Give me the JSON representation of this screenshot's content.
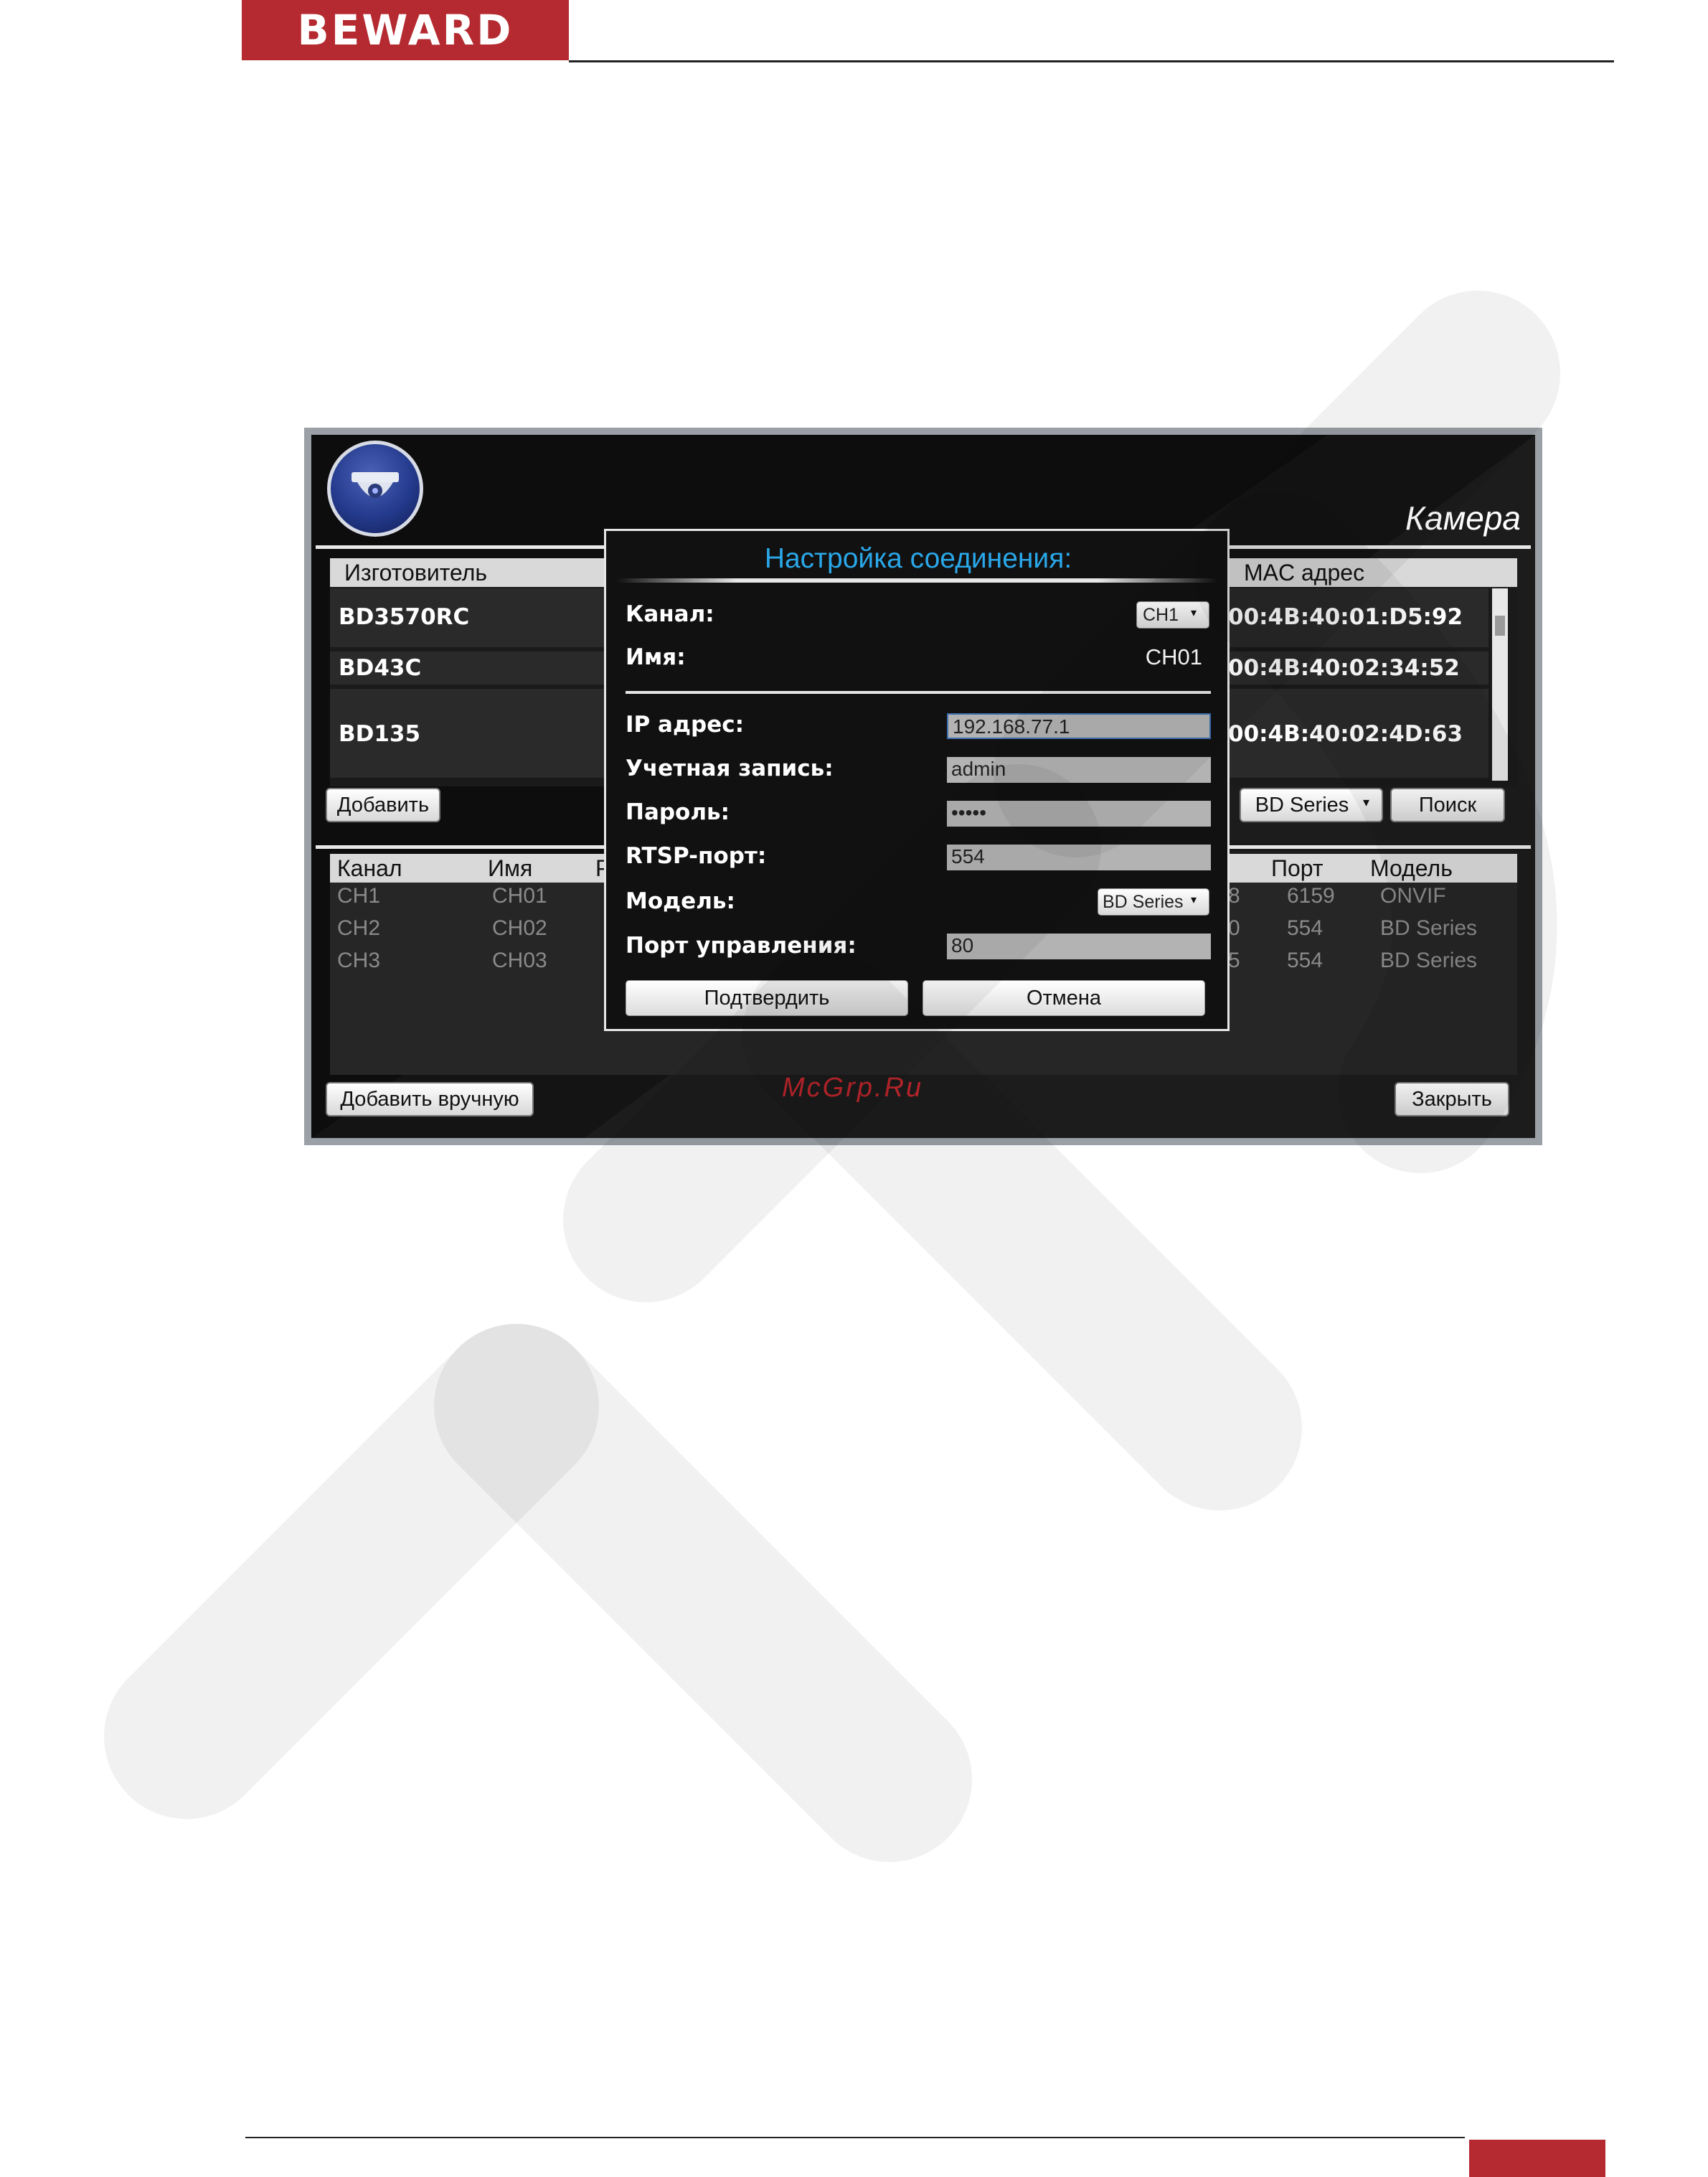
{
  "page": {
    "logo": "BEWARD",
    "footer_color": "#b52a30"
  },
  "app": {
    "title": "Камера",
    "camera_icon": "dome-camera-icon",
    "discovery_table": {
      "columns": [
        "Изготовитель",
        "MAC адрес"
      ],
      "rows": [
        {
          "maker": "BD3570RC",
          "mac": "00:4B:40:01:D5:92"
        },
        {
          "maker": "BD43C",
          "mac": "00:4B:40:02:34:52"
        },
        {
          "maker": "BD135",
          "mac": "00:4B:40:02:4D:63"
        }
      ]
    },
    "add_button": "Добавить",
    "series_select": "BD Series",
    "search_button": "Поиск",
    "channel_table": {
      "columns": [
        "Канал",
        "Имя",
        "Р",
        "Порт",
        "Модель"
      ],
      "rows": [
        {
          "channel": "CH1",
          "name": "CH01",
          "ip_tail": "8",
          "port": "6159",
          "model": "ONVIF"
        },
        {
          "channel": "CH2",
          "name": "CH02",
          "ip_tail": "0",
          "port": "554",
          "model": "BD Series"
        },
        {
          "channel": "CH3",
          "name": "CH03",
          "ip_tail": "5",
          "port": "554",
          "model": "BD Series"
        }
      ]
    },
    "add_manual_button": "Добавить вручную",
    "close_button": "Закрыть",
    "watermark_text": "McGrp.Ru"
  },
  "dialog": {
    "title": "Настройка соединения:",
    "channel_label": "Канал:",
    "channel_value": "CH1",
    "name_label": "Имя:",
    "name_value": "CH01",
    "ip_label": "IP адрес:",
    "ip_value": "192.168.77.1",
    "account_label": "Учетная запись:",
    "account_value": "admin",
    "password_label": "Пароль:",
    "password_value": "•••••",
    "rtsp_label": "RTSP-порт:",
    "rtsp_value": "554",
    "model_label": "Модель:",
    "model_value": "BD Series",
    "ctrl_port_label": "Порт управления:",
    "ctrl_port_value": "80",
    "confirm_button": "Подтвердить",
    "cancel_button": "Отмена"
  }
}
